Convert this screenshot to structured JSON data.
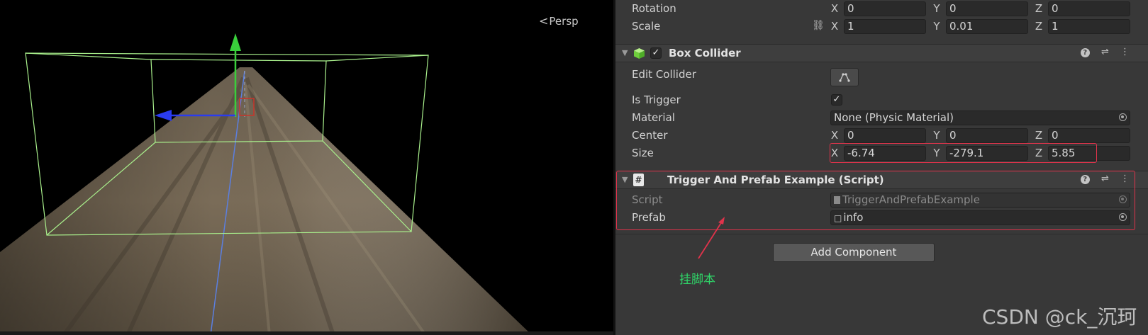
{
  "scene": {
    "camera_mode": "Persp"
  },
  "transform": {
    "rotation": {
      "label": "Rotation",
      "x": "0",
      "y": "0",
      "z": "0"
    },
    "scale": {
      "label": "Scale",
      "x": "1",
      "y": "0.01",
      "z": "1"
    }
  },
  "axis_labels": {
    "x": "X",
    "y": "Y",
    "z": "Z"
  },
  "box_collider": {
    "title": "Box Collider",
    "enabled": true,
    "edit_collider_label": "Edit Collider",
    "is_trigger_label": "Is Trigger",
    "is_trigger": true,
    "material_label": "Material",
    "material_value": "None (Physic Material)",
    "center_label": "Center",
    "center": {
      "x": "0",
      "y": "0",
      "z": "0"
    },
    "size_label": "Size",
    "size": {
      "x": "-6.74",
      "y": "-279.1",
      "z": "5.85"
    }
  },
  "script_component": {
    "title": "Trigger And Prefab Example (Script)",
    "script_label": "Script",
    "script_value": "TriggerAndPrefabExample",
    "prefab_label": "Prefab",
    "prefab_value": "info"
  },
  "add_component_label": "Add Component",
  "annotation_text": "挂脚本",
  "watermark": "CSDN @ck_沉珂",
  "colors": {
    "highlight": "#e0334b",
    "annotation": "#2fd468",
    "gizmo_y": "#39d03b",
    "gizmo_x": "#2a3cf0",
    "collider_wire": "#a9f08c"
  }
}
